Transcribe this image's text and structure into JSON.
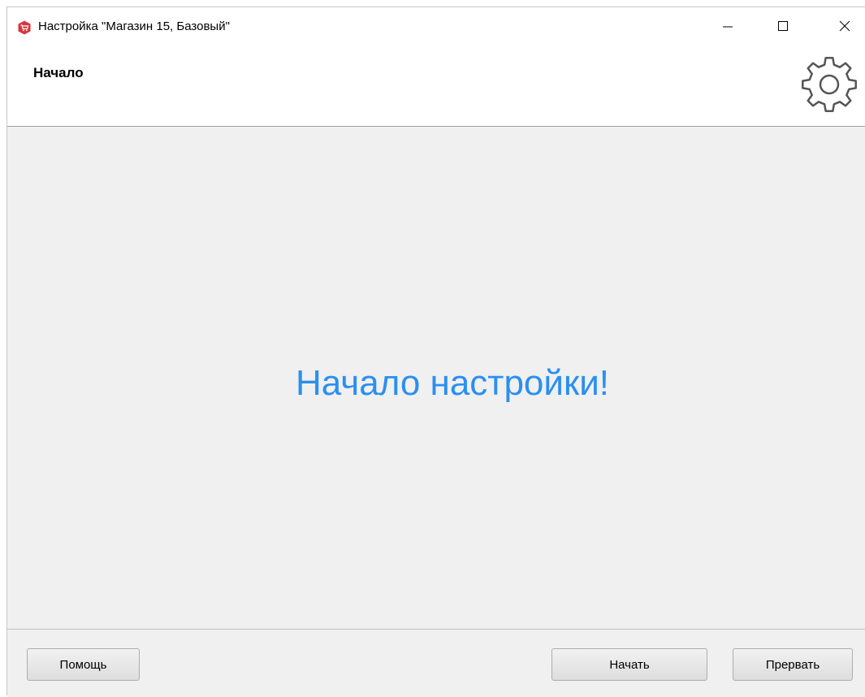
{
  "window": {
    "title": "Настройка \"Магазин 15, Базовый\"",
    "app_icon": "shop-cart-icon",
    "controls": {
      "minimize": "minimize-icon",
      "maximize": "maximize-icon",
      "close": "close-icon"
    }
  },
  "header": {
    "title": "Начало",
    "icon": "gear-icon"
  },
  "main": {
    "heading": "Начало настройки!"
  },
  "footer": {
    "help_label": "Помощь",
    "start_label": "Начать",
    "cancel_label": "Прервать"
  },
  "colors": {
    "accent": "#2b8ff0",
    "panel_bg": "#f0f0f0",
    "app_icon_red": "#d9363e"
  }
}
